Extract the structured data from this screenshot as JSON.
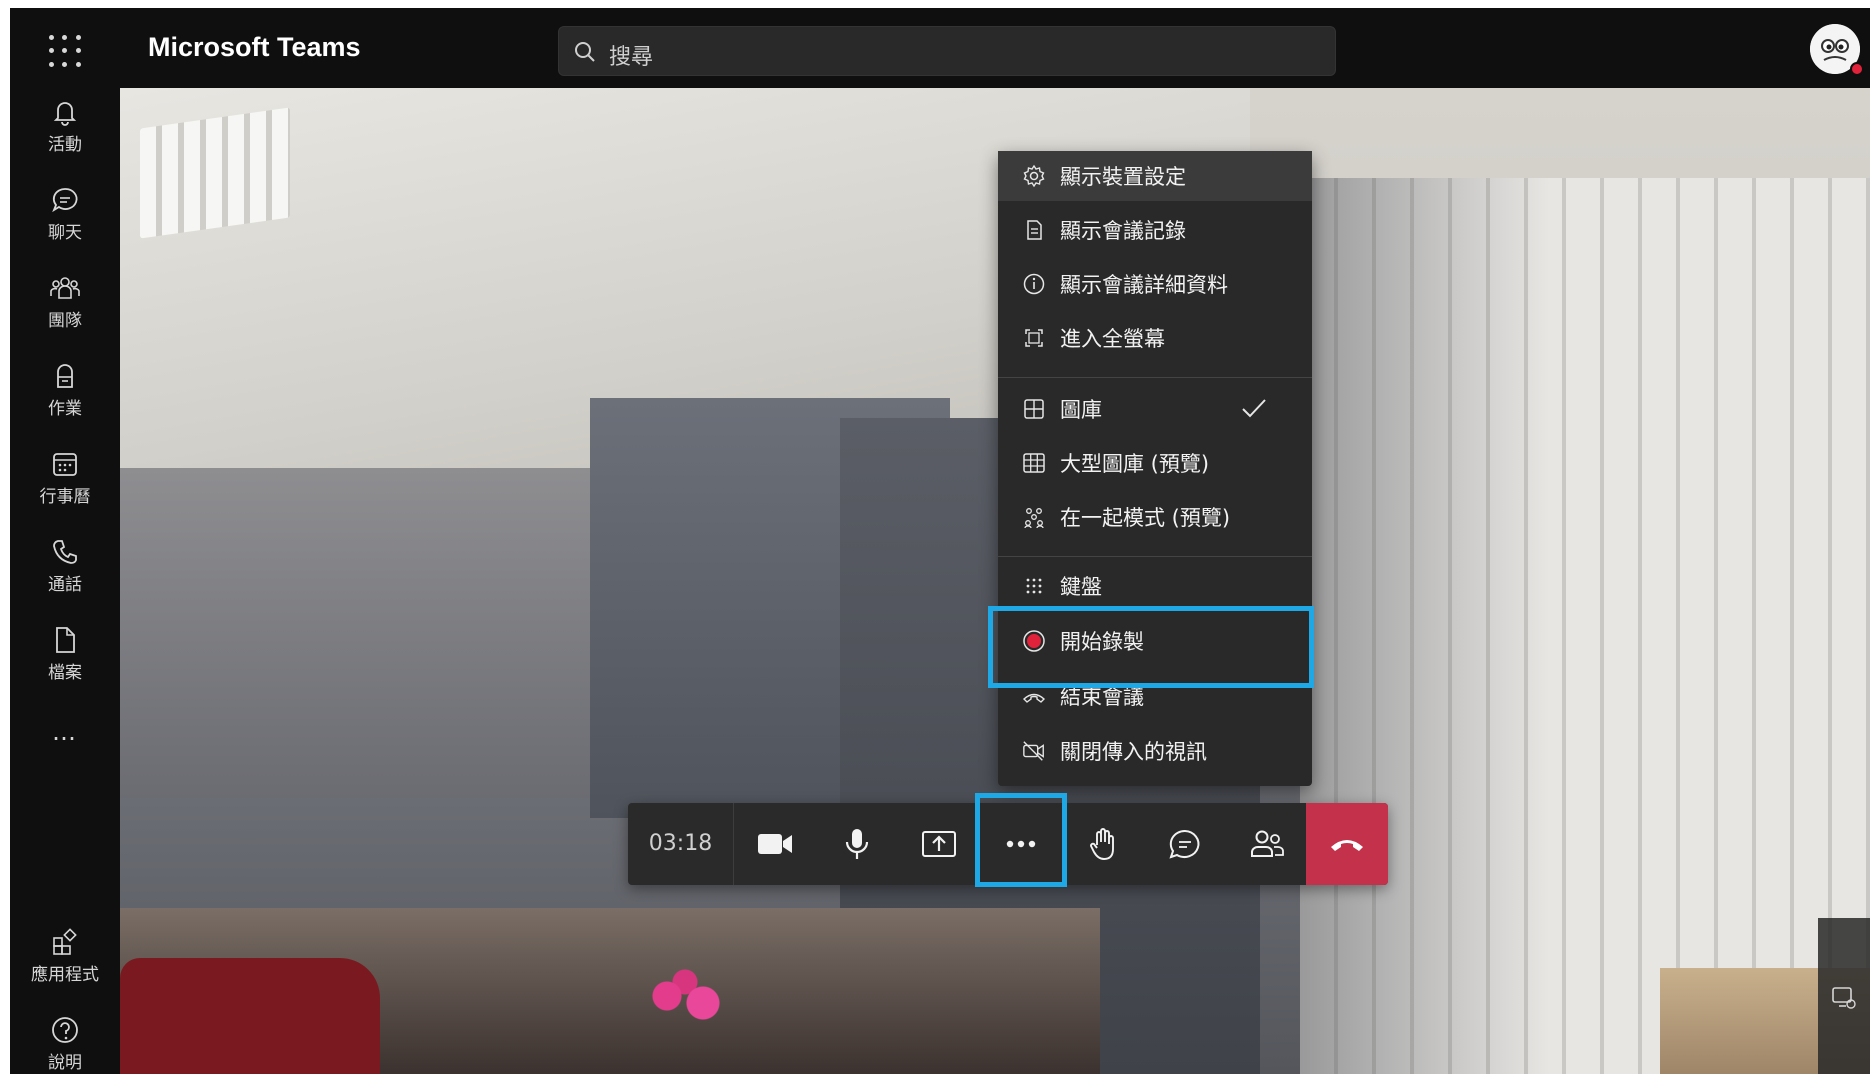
{
  "app": {
    "title": "Microsoft Teams"
  },
  "search": {
    "placeholder": "搜尋"
  },
  "rail": {
    "items": [
      {
        "label": "活動",
        "icon": "bell-icon"
      },
      {
        "label": "聊天",
        "icon": "chat-icon"
      },
      {
        "label": "團隊",
        "icon": "teams-icon"
      },
      {
        "label": "作業",
        "icon": "assignments-icon"
      },
      {
        "label": "行事曆",
        "icon": "calendar-icon"
      },
      {
        "label": "通話",
        "icon": "phone-icon"
      },
      {
        "label": "檔案",
        "icon": "file-icon"
      }
    ],
    "more": "…",
    "bottom": [
      {
        "label": "應用程式",
        "icon": "apps-icon"
      },
      {
        "label": "說明",
        "icon": "help-icon"
      }
    ]
  },
  "menu": {
    "items": [
      {
        "label": "顯示裝置設定",
        "icon": "gear-icon"
      },
      {
        "label": "顯示會議記錄",
        "icon": "notes-icon"
      },
      {
        "label": "顯示會議詳細資料",
        "icon": "info-icon"
      },
      {
        "label": "進入全螢幕",
        "icon": "fullscreen-icon"
      },
      {
        "label": "圖庫",
        "icon": "gallery-icon",
        "checked": true
      },
      {
        "label": "大型圖庫 (預覽)",
        "icon": "large-gallery-icon"
      },
      {
        "label": "在一起模式 (預覽)",
        "icon": "together-mode-icon"
      },
      {
        "label": "鍵盤",
        "icon": "keypad-icon"
      },
      {
        "label": "開始錄製",
        "icon": "record-icon"
      },
      {
        "label": "結束會議",
        "icon": "end-meeting-icon"
      },
      {
        "label": "關閉傳入的視訊",
        "icon": "video-off-icon"
      }
    ]
  },
  "toolbar": {
    "timer": "03:18",
    "buttons": [
      "camera-icon",
      "microphone-icon",
      "share-screen-icon",
      "more-options-icon",
      "raise-hand-icon",
      "chat-icon",
      "participants-icon",
      "hang-up-icon"
    ]
  },
  "colors": {
    "highlight": "#1ea9e6",
    "hangup": "#c4314b",
    "record": "#e0223a",
    "rail_bg": "#0f0f0f",
    "menu_bg": "#292929"
  }
}
